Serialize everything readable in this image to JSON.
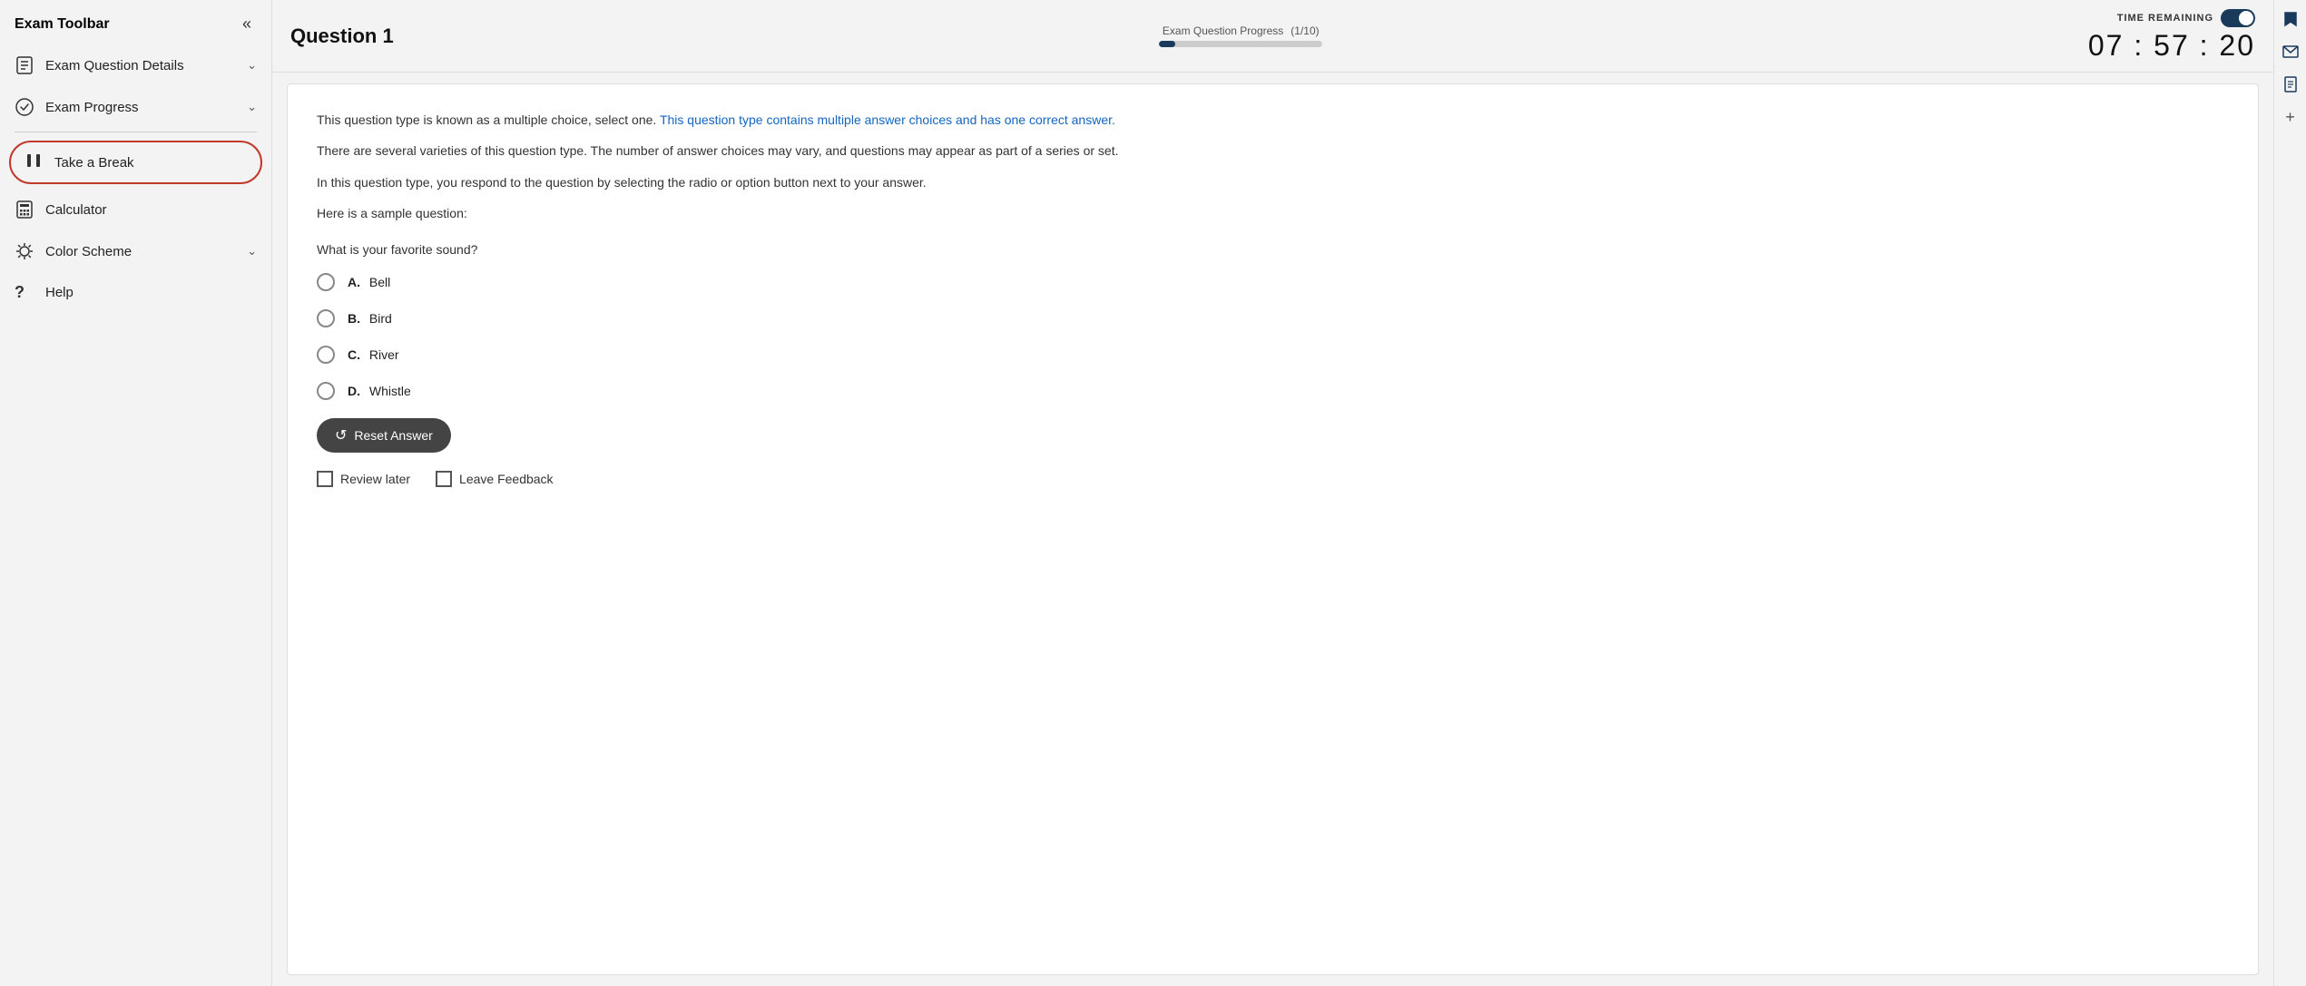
{
  "sidebar": {
    "title": "Exam Toolbar",
    "collapse_icon": "«",
    "items": [
      {
        "id": "exam-question-details",
        "label": "Exam Question Details",
        "icon": "📋",
        "has_chevron": true
      },
      {
        "id": "exam-progress",
        "label": "Exam Progress",
        "icon": "✔",
        "has_chevron": true
      },
      {
        "id": "take-a-break",
        "label": "Take a Break",
        "icon": "⏸",
        "has_chevron": false,
        "highlighted": true
      },
      {
        "id": "calculator",
        "label": "Calculator",
        "icon": "🗓",
        "has_chevron": false
      },
      {
        "id": "color-scheme",
        "label": "Color Scheme",
        "icon": "☀",
        "has_chevron": true
      },
      {
        "id": "help",
        "label": "Help",
        "icon": "?",
        "has_chevron": false
      }
    ]
  },
  "header": {
    "question_title": "Question 1",
    "progress_label": "Exam Question Progress",
    "progress_fraction": "(1/10)",
    "progress_percent": 10,
    "timer_label": "TIME REMAINING",
    "timer_value": "07 : 57 : 20",
    "timer_toggle_on": true
  },
  "content": {
    "description_1": "This question type is known as a multiple choice, select one.",
    "description_1_highlight": "This question type contains multiple answer choices and has one correct answer.",
    "description_2": "There are several varieties of this question type. The number of answer choices may vary, and questions may appear as part of a series or set.",
    "description_3": "In this question type, you respond to the question by selecting the radio or option button next to your answer.",
    "sample_label": "Here is a sample question:",
    "question_text": "What is your favorite sound?",
    "options": [
      {
        "letter": "A.",
        "text": "Bell"
      },
      {
        "letter": "B.",
        "text": "Bird"
      },
      {
        "letter": "C.",
        "text": "River"
      },
      {
        "letter": "D.",
        "text": "Whistle"
      }
    ],
    "reset_button_label": "Reset Answer",
    "review_later_label": "Review later",
    "leave_feedback_label": "Leave Feedback"
  },
  "right_icons": [
    "🔖",
    "✉",
    "📘",
    "+"
  ]
}
